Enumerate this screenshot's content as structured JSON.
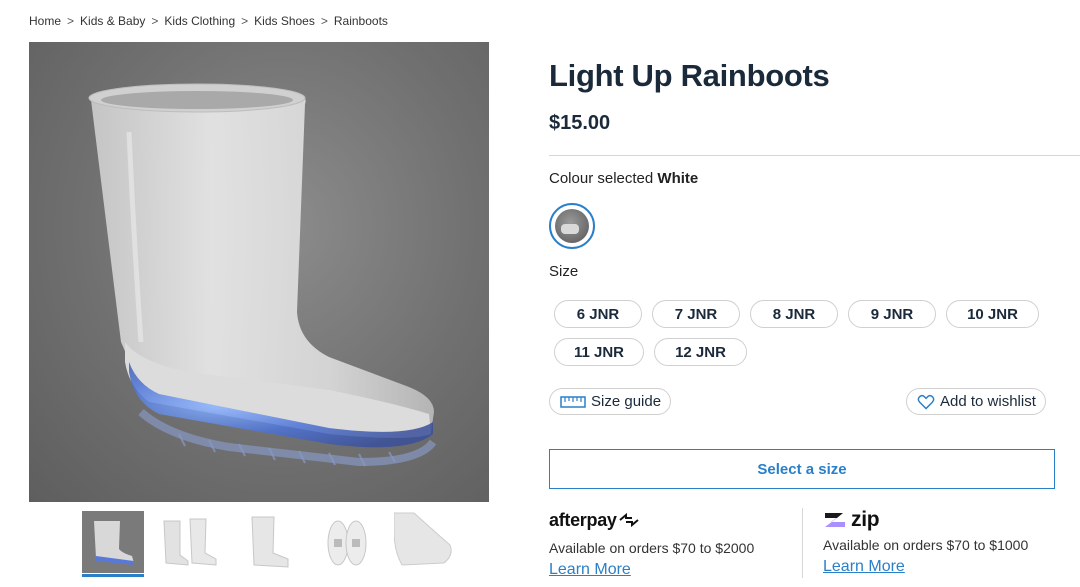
{
  "breadcrumb": {
    "items": [
      "Home",
      "Kids & Baby",
      "Kids Clothing",
      "Kids Shoes",
      "Rainboots"
    ],
    "separator": ">"
  },
  "product": {
    "title": "Light Up Rainboots",
    "price": "$15.00"
  },
  "colour": {
    "label": "Colour selected",
    "selected": "White"
  },
  "size": {
    "label": "Size",
    "options": [
      "6 JNR",
      "7 JNR",
      "8 JNR",
      "9 JNR",
      "10 JNR",
      "11 JNR",
      "12 JNR"
    ]
  },
  "actions": {
    "size_guide": "Size guide",
    "wishlist": "Add to wishlist",
    "select_size": "Select a size"
  },
  "payments": {
    "afterpay": {
      "logo": "afterpay",
      "text": "Available on orders $70 to $2000",
      "link": "Learn More"
    },
    "zip": {
      "logo": "zip",
      "text": "Available on orders $70 to $1000",
      "link": "Learn More"
    }
  },
  "gallery": {
    "thumbnail_count": 5,
    "active_index": 0
  },
  "colors": {
    "accent": "#2a7fc9",
    "heading": "#1b2a3a",
    "border": "#d0d0d0"
  }
}
